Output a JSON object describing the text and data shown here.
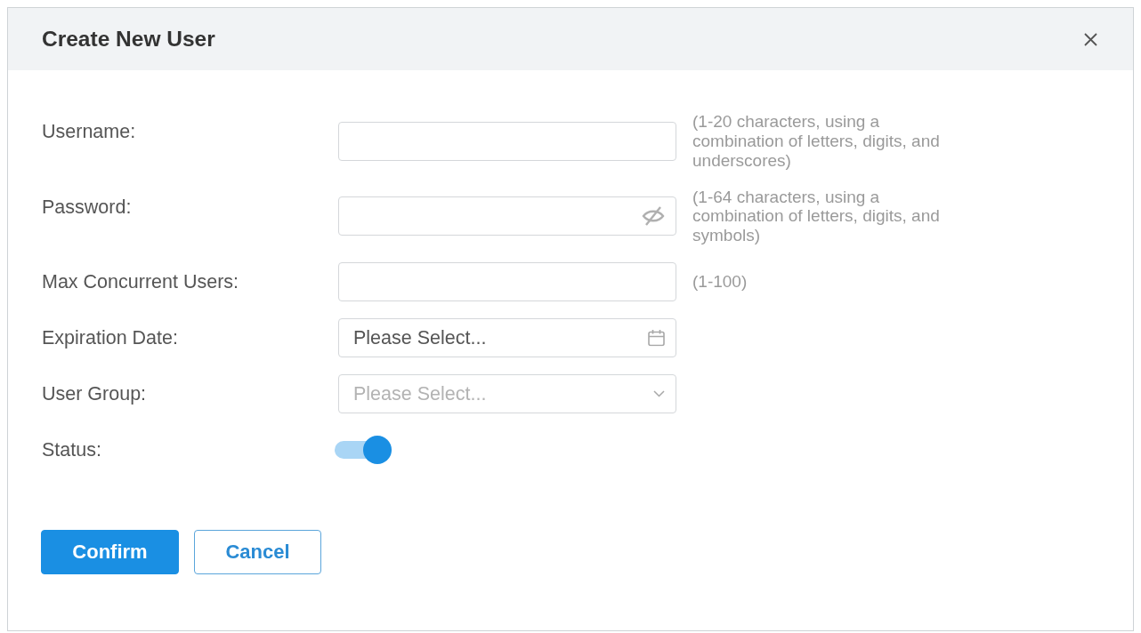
{
  "dialog": {
    "title": "Create New User"
  },
  "fields": [
    {
      "label": "Username:",
      "kind": "text",
      "hint": "(1-20 characters, using a combination of letters, digits, and underscores)"
    },
    {
      "label": "Password:",
      "kind": "password",
      "hint": "(1-64 characters, using a combination of letters, digits, and symbols)"
    },
    {
      "label": "Max Concurrent Users:",
      "kind": "text",
      "hint": "(1-100)"
    },
    {
      "label": "Expiration Date:",
      "kind": "date",
      "placeholder": "Please Select..."
    },
    {
      "label": "User Group:",
      "kind": "select",
      "placeholder": "Please Select..."
    },
    {
      "label": "Status:",
      "kind": "toggle",
      "on": true
    }
  ],
  "buttons": [
    {
      "label": "Confirm",
      "kind": "primary"
    },
    {
      "label": "Cancel",
      "kind": "secondary"
    }
  ]
}
